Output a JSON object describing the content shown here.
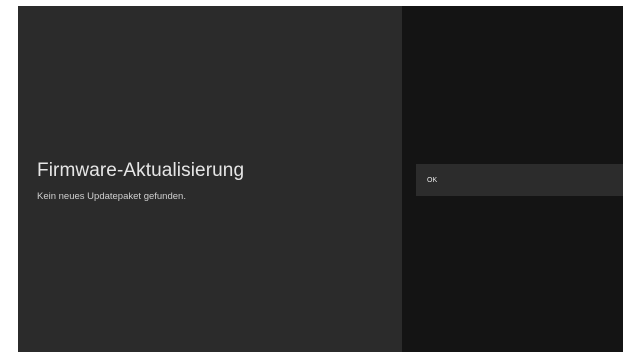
{
  "guidance": {
    "title": "Firmware-Aktualisierung",
    "description": "Kein neues Updatepaket gefunden."
  },
  "actions": [
    {
      "label": "OK"
    }
  ],
  "colors": {
    "guidance_bg": "#2b2b2b",
    "action_panel_bg": "#141414",
    "action_item_bg": "#2c2c2c",
    "text_primary": "#e6e6e6"
  }
}
